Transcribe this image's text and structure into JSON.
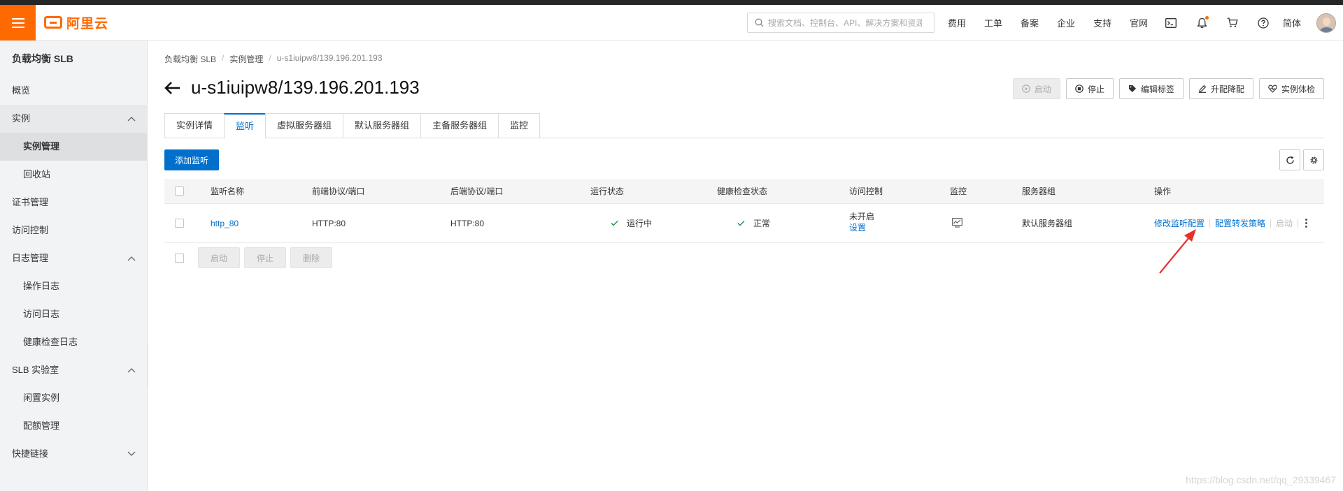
{
  "topbar": {
    "logo_text": "阿里云",
    "search_placeholder": "搜索文档、控制台、API、解决方案和资源",
    "links": [
      "费用",
      "工单",
      "备案",
      "企业",
      "支持",
      "官网"
    ],
    "icons": [
      "terminal-icon",
      "bell-icon",
      "cart-icon",
      "help-icon"
    ],
    "lang": "简体",
    "brand_color": "#ff6a00"
  },
  "sidebar": {
    "title": "负载均衡 SLB",
    "items": {
      "overview": "概览",
      "instance": "实例",
      "instance_mgmt": "实例管理",
      "recycle": "回收站",
      "cert": "证书管理",
      "acl": "访问控制",
      "log": "日志管理",
      "op_log": "操作日志",
      "access_log": "访问日志",
      "health_log": "健康检查日志",
      "lab": "SLB 实验室",
      "idle": "闲置实例",
      "quota": "配额管理",
      "shortcuts": "快捷链接"
    }
  },
  "breadcrumb": [
    "负载均衡 SLB",
    "实例管理",
    "u-s1iuipw8/139.196.201.193"
  ],
  "page_title": "u-s1iuipw8/139.196.201.193",
  "header_actions": {
    "start": "启动",
    "stop": "停止",
    "edit_tags": "编辑标签",
    "resize": "升配降配",
    "check": "实例体检"
  },
  "tabs": [
    "实例详情",
    "监听",
    "虚拟服务器组",
    "默认服务器组",
    "主备服务器组",
    "监控"
  ],
  "active_tab": "监听",
  "add_listener": "添加监听",
  "table": {
    "headers": {
      "name": "监听名称",
      "front": "前端协议/端口",
      "back": "后端协议/端口",
      "run": "运行状态",
      "health": "健康检查状态",
      "acl": "访问控制",
      "monitor": "监控",
      "group": "服务器组",
      "ops": "操作"
    },
    "row": {
      "name": "http_80",
      "front": "HTTP:80",
      "back": "HTTP:80",
      "run": "运行中",
      "health": "正常",
      "acl_status": "未开启",
      "acl_link": "设置",
      "group": "默认服务器组",
      "op_modify": "修改监听配置",
      "op_forward": "配置转发策略",
      "op_start": "启动"
    }
  },
  "batch": {
    "start": "启动",
    "stop": "停止",
    "delete": "删除"
  },
  "watermark": "https://blog.csdn.net/qq_29339467",
  "colors": {
    "primary": "#0070cc",
    "success": "#1e8e3e",
    "annotation": "#e8302a"
  }
}
